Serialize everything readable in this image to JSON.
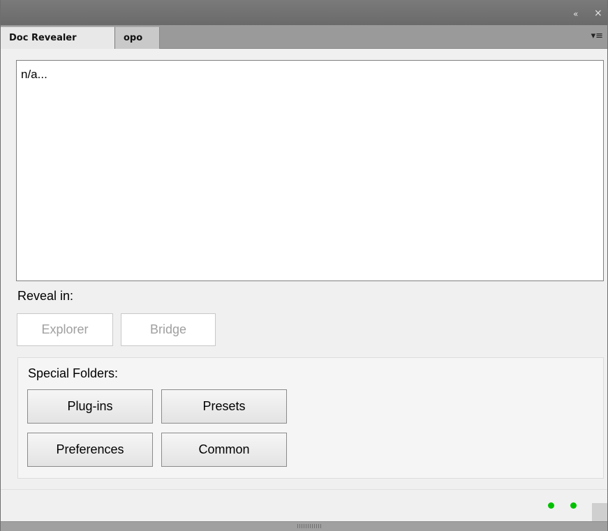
{
  "titlebar": {
    "collapse_icon": "double-chevron-left-icon",
    "collapse_glyph": "«",
    "close_icon": "close-icon",
    "close_glyph": "×"
  },
  "tabs": [
    {
      "label": "Doc Revealer",
      "active": true
    },
    {
      "label": "opo",
      "active": false
    }
  ],
  "tab_menu": {
    "icon": "panel-menu-icon",
    "glyph": "▾≡"
  },
  "path_box": {
    "text": "n/a..."
  },
  "reveal": {
    "label": "Reveal in:",
    "explorer": "Explorer",
    "bridge": "Bridge"
  },
  "special": {
    "label": "Special Folders:",
    "plugins": "Plug-ins",
    "presets": "Presets",
    "preferences": "Preferences",
    "common": "Common"
  },
  "status": {
    "indicator_color": "#00c000"
  },
  "colors": {
    "titlebar": "#6a6a6a",
    "tabbar": "#9a9a9a",
    "panel_bg": "#f0f0f0"
  }
}
